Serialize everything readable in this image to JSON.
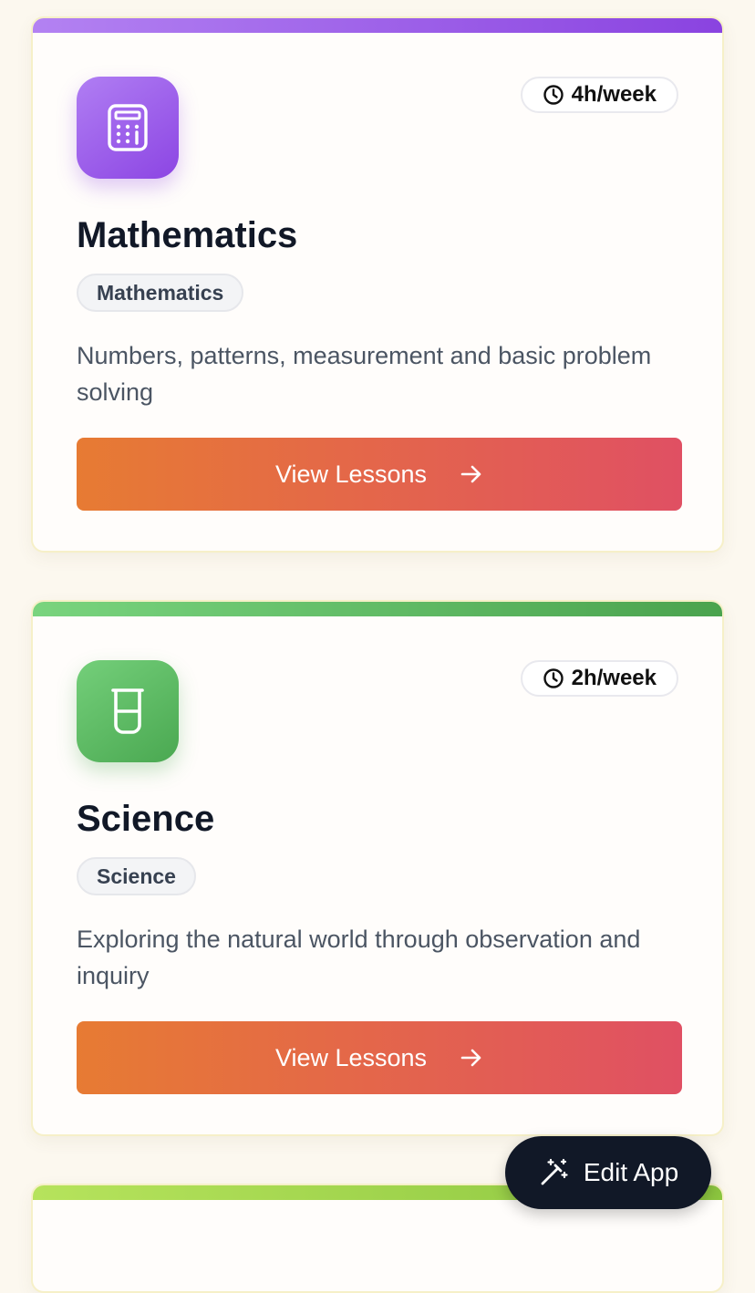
{
  "subjects": [
    {
      "title": "Mathematics",
      "tag": "Mathematics",
      "hours": "4h/week",
      "description": "Numbers, patterns, measurement and basic problem solving",
      "button_label": "View Lessons",
      "icon": "calculator-icon",
      "accent_colors": [
        "#b07ef3",
        "#8c45e3"
      ]
    },
    {
      "title": "Science",
      "tag": "Science",
      "hours": "2h/week",
      "description": "Exploring the natural world through observation and inquiry",
      "button_label": "View Lessons",
      "icon": "beaker-icon",
      "accent_colors": [
        "#74cf7a",
        "#4aa851"
      ]
    }
  ],
  "partial_card": {
    "accent_colors": [
      "#b6e35c",
      "#8cc63f"
    ]
  },
  "edit_app": {
    "label": "Edit App",
    "icon": "magic-wand-icon"
  },
  "button_gradient": [
    "#e77b33",
    "#e05063"
  ]
}
